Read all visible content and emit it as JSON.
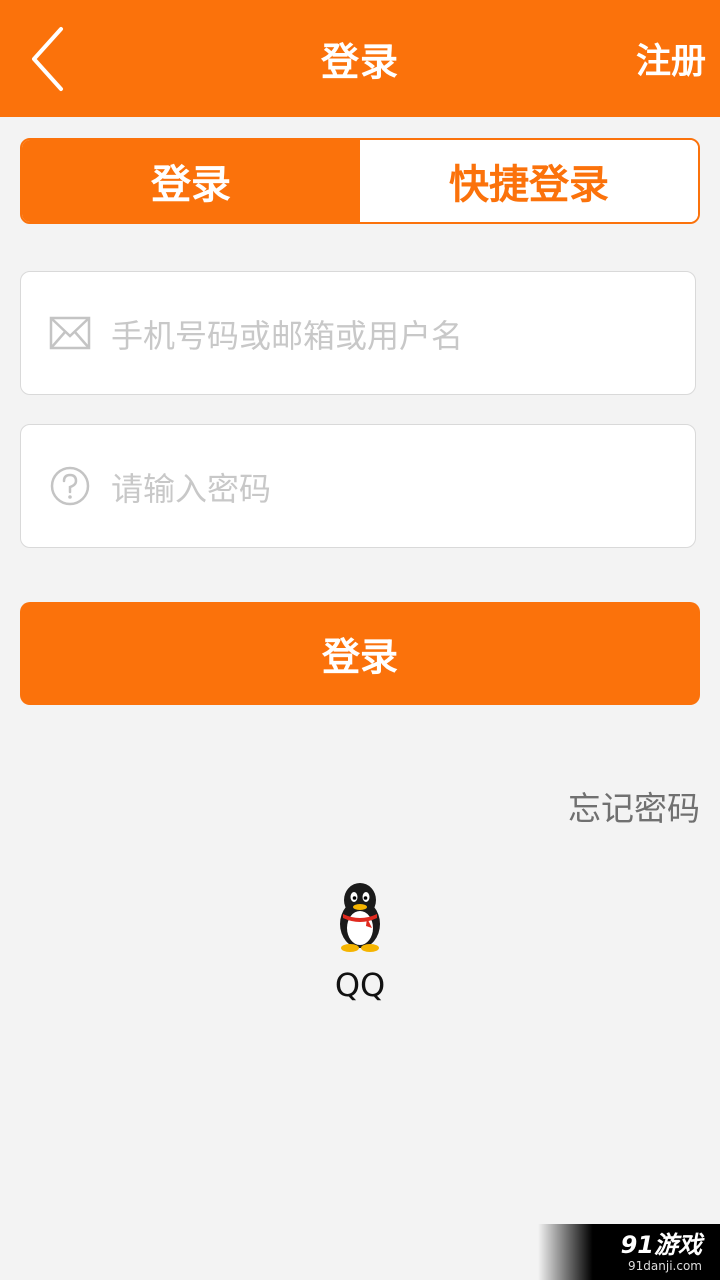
{
  "header": {
    "title": "登录",
    "register_label": "注册",
    "back_icon": "chevron-left-icon"
  },
  "tabs": [
    {
      "label": "登录",
      "active": true
    },
    {
      "label": "快捷登录",
      "active": false
    }
  ],
  "form": {
    "account": {
      "placeholder": "手机号码或邮箱或用户名",
      "value": "",
      "icon": "mail-icon"
    },
    "password": {
      "placeholder": "请输入密码",
      "value": "",
      "icon": "question-icon"
    },
    "submit_label": "登录",
    "forgot_label": "忘记密码"
  },
  "social": {
    "qq_label": "QQ",
    "qq_icon": "qq-penguin-icon"
  },
  "watermark": {
    "main": "91游戏",
    "sub": "91danji.com"
  },
  "colors": {
    "accent": "#fb720b",
    "background": "#f3f3f3"
  }
}
